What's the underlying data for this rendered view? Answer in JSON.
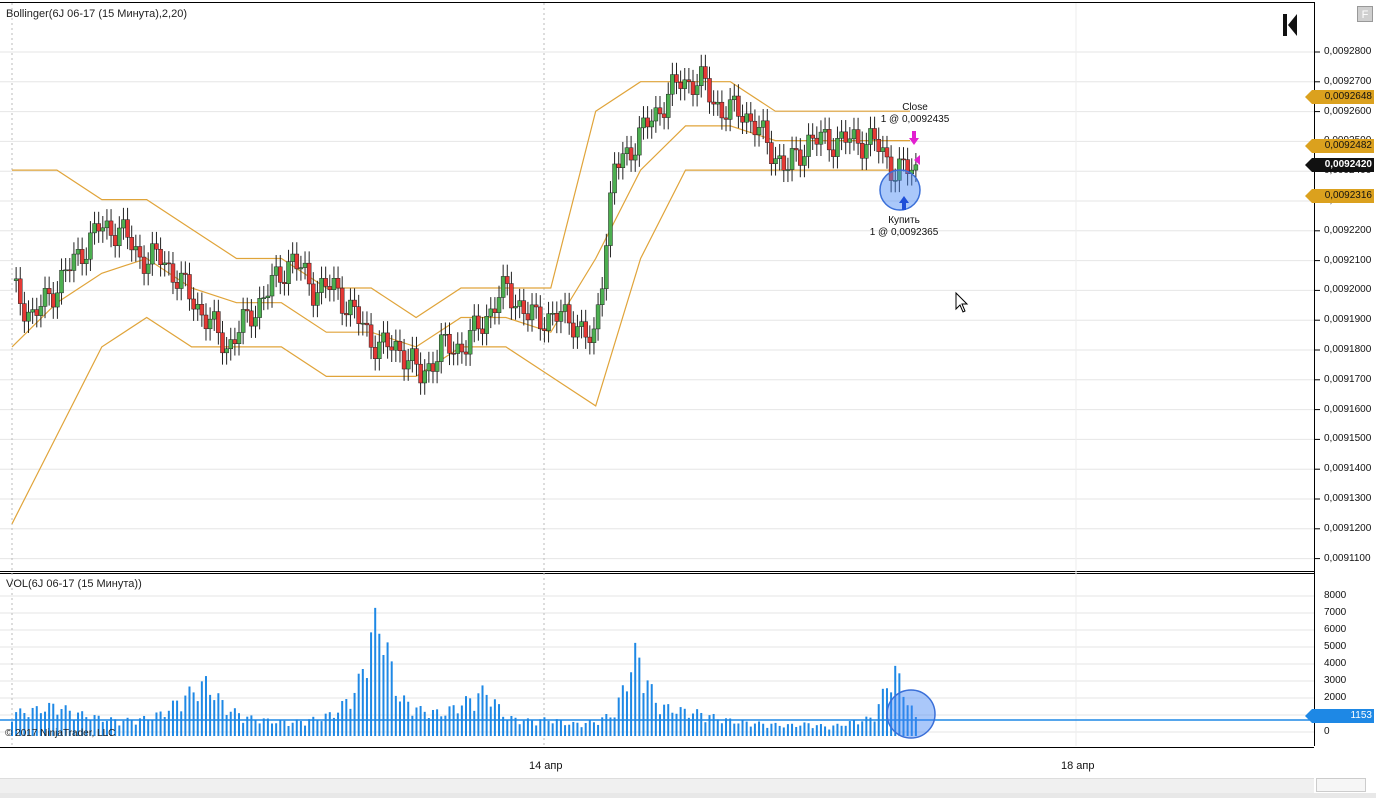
{
  "price_pane": {
    "label": "Bollinger(6J 06-17 (15 Минута),2,20)",
    "y_ticks": [
      "0,0092800",
      "0,0092700",
      "0,0092600",
      "0,0092500",
      "0,0092400",
      "0,0092300",
      "0,0092200",
      "0,0092100",
      "0,0092000",
      "0,0091900",
      "0,0091800",
      "0,0091700",
      "0,0091600",
      "0,0091500",
      "0,0091400",
      "0,0091300",
      "0,0091200",
      "0,0091100"
    ],
    "price_tags": [
      {
        "value": "0,0092648",
        "style": "gold"
      },
      {
        "value": "0,0092482",
        "style": "gold"
      },
      {
        "value": "0,0092420",
        "style": "dark"
      },
      {
        "value": "0,0092316",
        "style": "gold"
      }
    ],
    "colors": {
      "up": "#4caf50",
      "down": "#e53935",
      "bands": "#e0a43a",
      "grid": "#e6e6e6"
    }
  },
  "volume_pane": {
    "label": "VOL(6J 06-17 (15 Минута))",
    "y_ticks": [
      "8000",
      "7000",
      "6000",
      "5000",
      "4000",
      "3000",
      "2000",
      "1000",
      "0"
    ],
    "current_tag": "1153",
    "color": "#1e88e5"
  },
  "x_axis": {
    "labels": [
      "14 апр",
      "18 апр"
    ]
  },
  "annotations": {
    "close_title": "Close",
    "close_detail": "1 @ 0,0092435",
    "buy_title": "Купить",
    "buy_detail": "1 @ 0,0092365"
  },
  "copyright": "© 2017 NinjaTrader, LLC",
  "f_button": "F",
  "icons": [
    "ninjatrader-logo-icon",
    "cursor-arrow-icon",
    "sell-arrow-icon",
    "buy-arrow-icon"
  ],
  "chart_data": {
    "type": "candlestick",
    "title": "Bollinger(6J 06-17 (15 Минута),2,20)",
    "ylim": [
      0.009105,
      0.009295
    ],
    "x_labels": [
      "14 апр",
      "18 апр"
    ],
    "close_path": [
      0.0092,
      0.00919,
      0.0092,
      0.00921,
      0.00922,
      0.00922,
      0.00921,
      0.00921,
      0.0092,
      0.00919,
      0.00918,
      0.00919,
      0.0092,
      0.00921,
      0.0092,
      0.0092,
      0.00919,
      0.00918,
      0.00918,
      0.00917,
      0.00918,
      0.00918,
      0.00919,
      0.0092,
      0.00919,
      0.00919,
      0.00919,
      0.00918,
      0.00924,
      0.00925,
      0.00926,
      0.00927,
      0.00927,
      0.00926,
      0.00926,
      0.00925,
      0.00924,
      0.00925,
      0.00925,
      0.00925,
      0.00925,
      0.00924,
      0.00924
    ],
    "volume": [
      1500,
      1700,
      2000,
      1500,
      1200,
      1000,
      1100,
      1500,
      2600,
      3500,
      1800,
      1200,
      1000,
      900,
      1100,
      1500,
      3000,
      8000,
      2500,
      1700,
      1500,
      2200,
      3000,
      1200,
      1000,
      1100,
      800,
      900,
      1500,
      5500,
      2000,
      1700,
      1500,
      1100,
      900,
      800,
      700,
      800,
      600,
      900,
      1200,
      4400,
      1153
    ],
    "band_upper": [
      0.00924,
      0.00924,
      0.00923,
      0.00923,
      0.00922,
      0.00921,
      0.00921,
      0.0092,
      0.0092,
      0.00919,
      0.0092,
      0.0092,
      0.0092,
      0.00926,
      0.00927,
      0.00927,
      0.00927,
      0.00926,
      0.00926,
      0.00926,
      0.00926
    ],
    "band_lower": [
      0.00912,
      0.00915,
      0.00918,
      0.00919,
      0.00918,
      0.00918,
      0.00918,
      0.00917,
      0.00917,
      0.00917,
      0.00918,
      0.00918,
      0.00917,
      0.00916,
      0.00921,
      0.00924,
      0.00924,
      0.00924,
      0.00924,
      0.00924,
      0.00924
    ],
    "series": [
      {
        "name": "Bollinger upper",
        "color": "#e0a43a"
      },
      {
        "name": "Bollinger middle",
        "color": "#e0a43a"
      },
      {
        "name": "Bollinger lower",
        "color": "#e0a43a"
      },
      {
        "name": "VOL",
        "color": "#1e88e5"
      }
    ]
  }
}
